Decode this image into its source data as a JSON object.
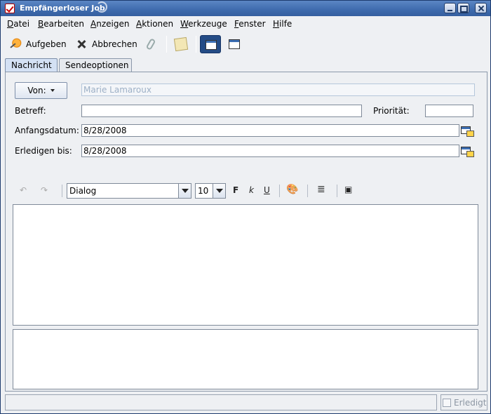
{
  "window": {
    "title": "Empfängerloser Job"
  },
  "menu": [
    "Datei",
    "Bearbeiten",
    "Anzeigen",
    "Aktionen",
    "Werkzeuge",
    "Fenster",
    "Hilfe"
  ],
  "toolbar": {
    "submit_label": "Aufgeben",
    "cancel_label": "Abbrechen"
  },
  "tabs": [
    "Nachricht",
    "Sendeoptionen"
  ],
  "form": {
    "from_button": "Von:",
    "from_value": "Marie Lamaroux",
    "subject_label": "Betreff:",
    "subject_value": "",
    "priority_label": "Priorität:",
    "priority_value": "",
    "start_label": "Anfangsdatum:",
    "start_value": "8/28/2008",
    "due_label": "Erledigen bis:",
    "due_value": "8/28/2008"
  },
  "format": {
    "font": "Dialog",
    "size": "10",
    "bold": "F",
    "italic": "k",
    "underline": "U"
  },
  "status": {
    "text": "",
    "done_label": "Erledigt"
  }
}
